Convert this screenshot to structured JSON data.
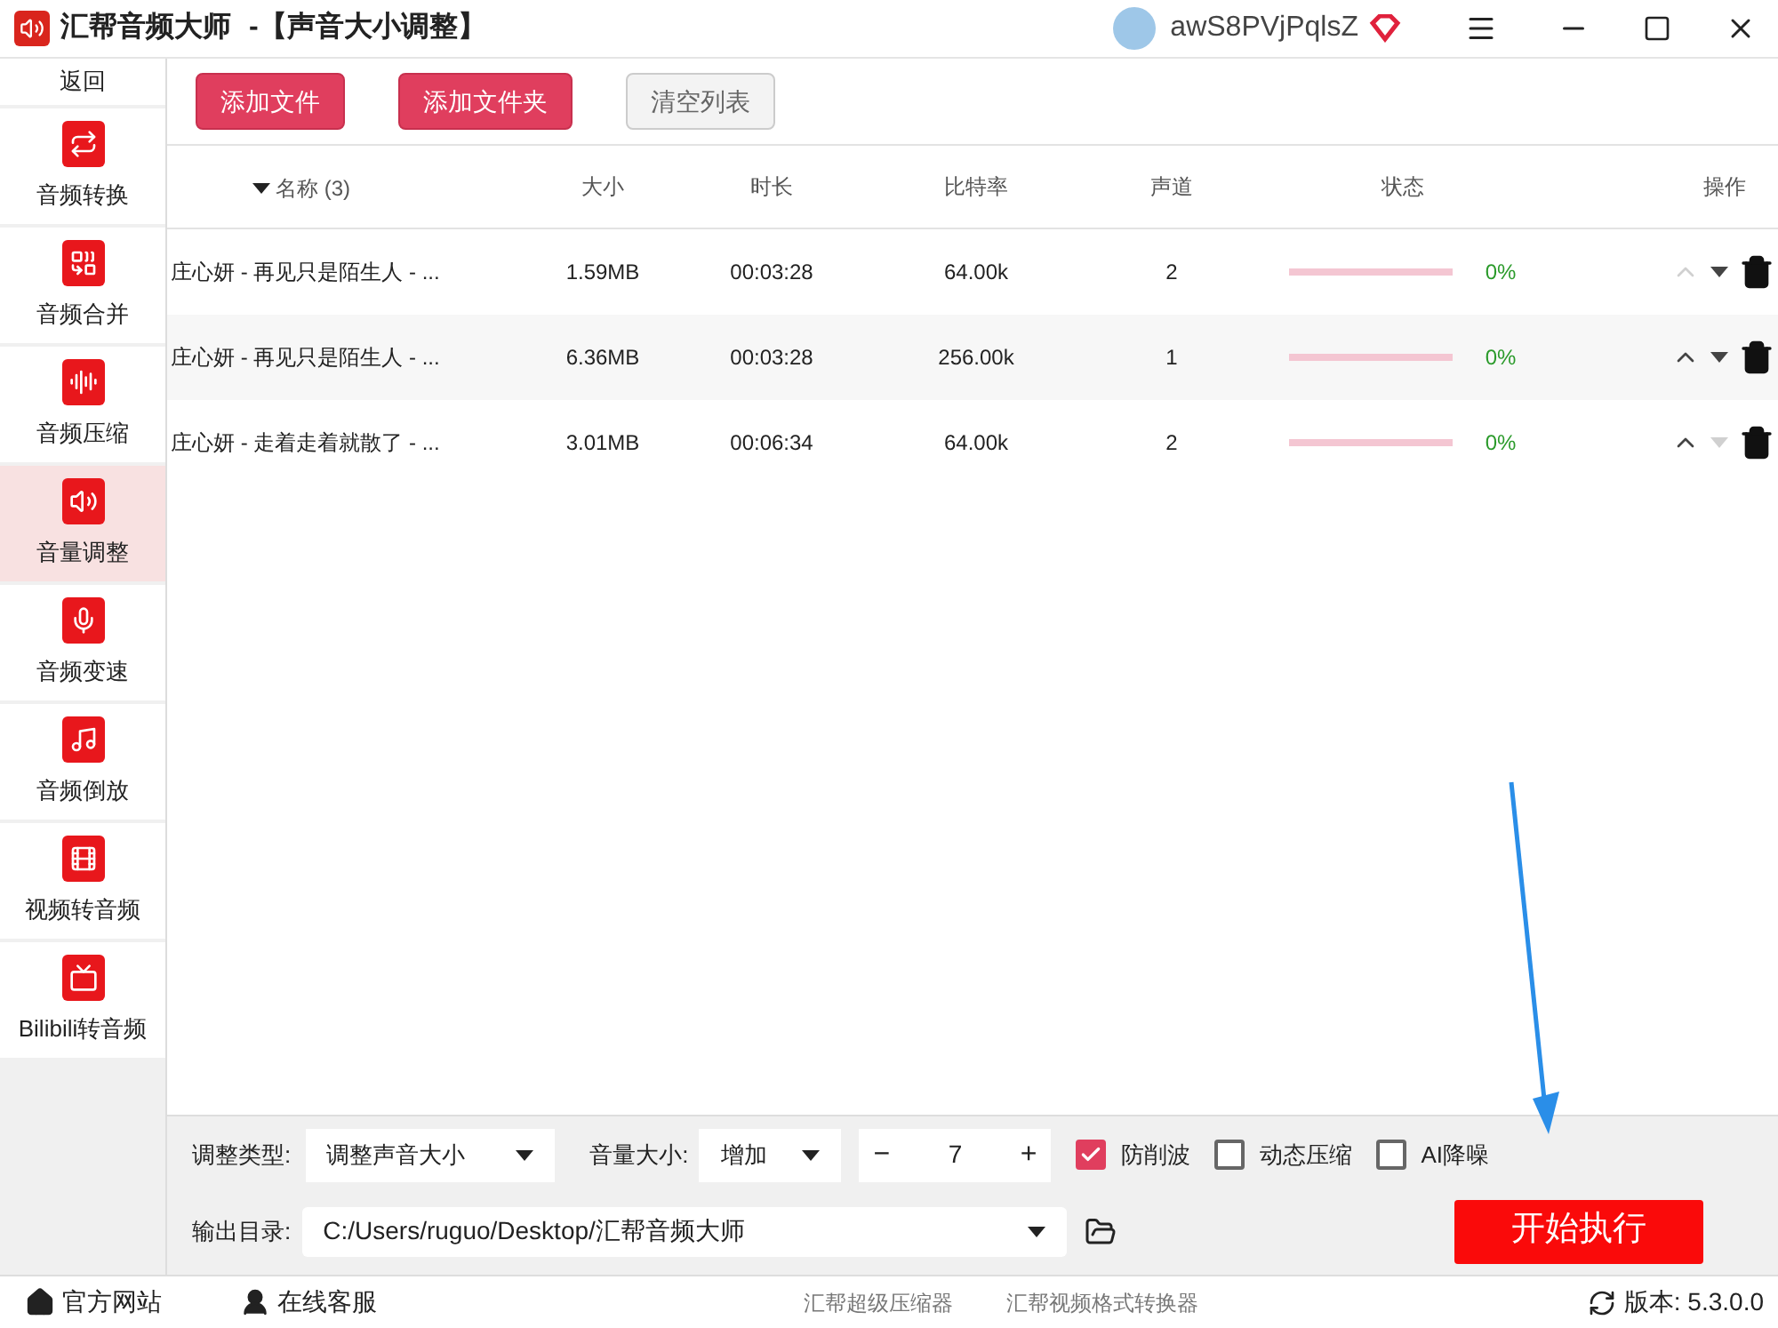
{
  "window": {
    "app_name": "汇帮音频大师",
    "title": "-【声音大小调整】",
    "user": "awS8PVjPqlsZ"
  },
  "sidebar": {
    "back": "返回",
    "items": [
      {
        "label": "音频转换",
        "selected": false
      },
      {
        "label": "音频合并",
        "selected": false
      },
      {
        "label": "音频压缩",
        "selected": false
      },
      {
        "label": "音量调整",
        "selected": true
      },
      {
        "label": "音频变速",
        "selected": false
      },
      {
        "label": "音频倒放",
        "selected": false
      },
      {
        "label": "视频转音频",
        "selected": false
      },
      {
        "label": "Bilibili转音频",
        "selected": false
      }
    ]
  },
  "toolbar": {
    "buttons": [
      {
        "label": "添加文件",
        "kind": "primary"
      },
      {
        "label": "添加文件夹",
        "kind": "primary"
      },
      {
        "label": "清空列表",
        "kind": "secondary"
      }
    ]
  },
  "table": {
    "columns": [
      "名称 (3)",
      "大小",
      "时长",
      "比特率",
      "声道",
      "状态",
      "操作"
    ],
    "rows": [
      {
        "name": "庄心妍 - 再见只是陌生人 - ...",
        "size": "1.59MB",
        "duration": "00:03:28",
        "bitrate": "64.00k",
        "channels": "2",
        "level": 0,
        "progress": "0%",
        "up_disabled": true,
        "down_disabled": false
      },
      {
        "name": "庄心妍 - 再见只是陌生人 - ...",
        "size": "6.36MB",
        "duration": "00:03:28",
        "bitrate": "256.00k",
        "channels": "1",
        "level": 0,
        "progress": "0%",
        "up_disabled": false,
        "down_disabled": false
      },
      {
        "name": "庄心妍 - 走着走着就散了 - ...",
        "size": "3.01MB",
        "duration": "00:06:34",
        "bitrate": "64.00k",
        "channels": "2",
        "level": 0,
        "progress": "0%",
        "up_disabled": false,
        "down_disabled": true
      }
    ]
  },
  "settings": {
    "adjust_type_label": "调整类型:",
    "adjust_type": "调整声音大小",
    "volume_label": "音量大小:",
    "volume_mode": "增加",
    "minus": "−",
    "value": "7",
    "plus": "+",
    "options": [
      {
        "label": "防削波",
        "checked": true
      },
      {
        "label": "动态压缩",
        "checked": false
      },
      {
        "label": "AI降噪",
        "checked": false
      }
    ],
    "output_label": "输出目录:",
    "output_dir": "C:/Users/ruguo/Desktop/汇帮音频大师",
    "start": "开始执行"
  },
  "status_bar": {
    "website": "官方网站",
    "support": "在线客服",
    "links": [
      "汇帮超级压缩器",
      "汇帮视频格式转换器"
    ],
    "version": "版本:  5.3.0.0"
  }
}
